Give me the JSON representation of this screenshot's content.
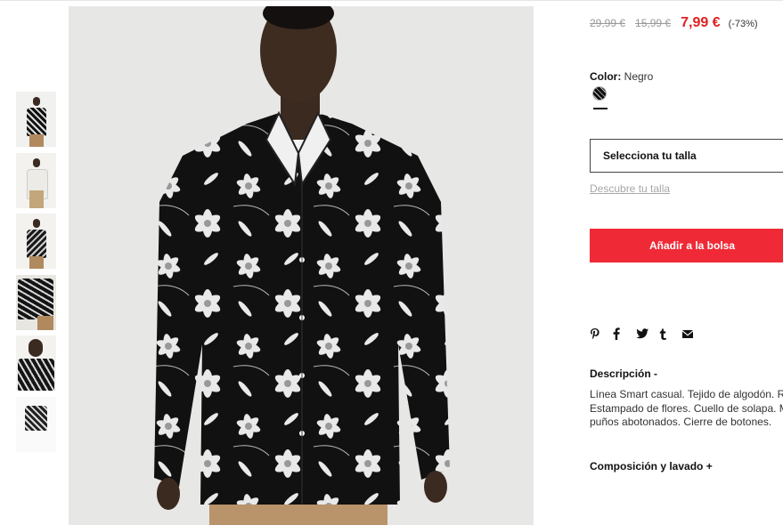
{
  "product": {
    "image_alt": "Camisa estampado flores",
    "thumbnail_count": 6
  },
  "price": {
    "original": "29,99 €",
    "previous": "15,99 €",
    "current": "7,99 €",
    "discount": "(-73%)"
  },
  "color": {
    "label": "Color:",
    "value": "Negro"
  },
  "size": {
    "select_label": "Selecciona tu talla",
    "guide_link": "Descubre tu talla"
  },
  "actions": {
    "add_to_bag": "Añadir a la bolsa"
  },
  "share_icons": [
    "pinterest-icon",
    "facebook-icon",
    "twitter-icon",
    "tumblr-icon",
    "email-icon"
  ],
  "description": {
    "title": "Descripción -",
    "lines": [
      "Línea Smart casual. Tejido de algodón. Re",
      "Estampado de flores. Cuello de solapa. M",
      "puños abotonados. Cierre de botones."
    ]
  },
  "composition": {
    "title": "Composición y lavado +"
  },
  "colors": {
    "accent_red": "#ef2a36",
    "price_red": "#e02020"
  }
}
